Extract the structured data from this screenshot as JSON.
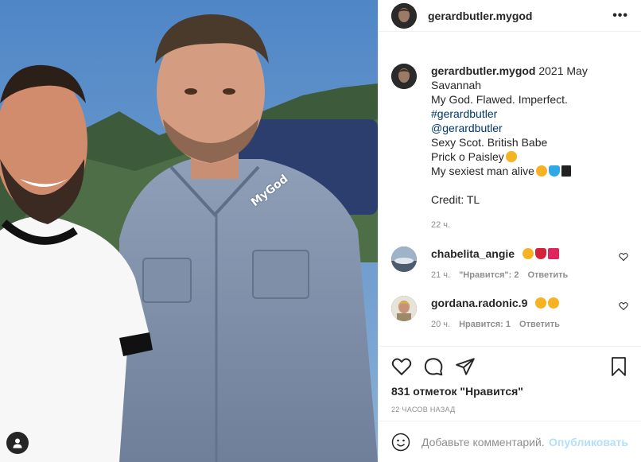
{
  "post": {
    "username": "gerardbutler.mygod",
    "more_icon": "more-options-icon",
    "watermark": "MyGod"
  },
  "caption": {
    "username": "gerardbutler.mygod",
    "lines": [
      "2021 May",
      "Savannah",
      "My God. Flawed. Imperfect.",
      "#gerardbutler",
      "@gerardbutler",
      "Sexy Scot. British Babe",
      "Prick o Paisley",
      "My sexiest man alive",
      "Credit: TL"
    ],
    "time": "22 ч."
  },
  "comments": [
    {
      "username": "chabelita_angie",
      "time": "21 ч.",
      "likes": "\"Нравится\": 2",
      "reply": "Ответить"
    },
    {
      "username": "gordana.radonic.9",
      "time": "20 ч.",
      "likes": "Нравится: 1",
      "reply": "Ответить"
    }
  ],
  "actions": {
    "likes_text": "831 отметок \"Нравится\"",
    "post_time": "22 ЧАСОВ НАЗАД"
  },
  "add_comment": {
    "placeholder": "Добавьте комментарий...",
    "publish": "Опубликовать"
  },
  "colors": {
    "link": "#00376b",
    "publish": "#b2dffc",
    "meta": "#8e8e8e",
    "border": "#efefef"
  }
}
